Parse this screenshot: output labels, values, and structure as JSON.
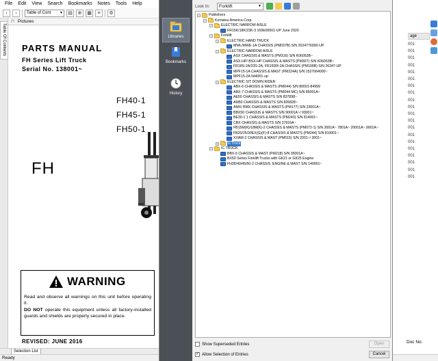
{
  "menubar": {
    "items": [
      "File",
      "Edit",
      "View",
      "Search",
      "Bookmarks",
      "Notes",
      "Tools",
      "Help"
    ]
  },
  "toolbar": {
    "toc_select": "Table of Cont"
  },
  "left_tabs": {
    "toc_tab": "Table Of Contents"
  },
  "pictures_panel": {
    "title": "Pictures"
  },
  "document": {
    "title": "PARTS MANUAL",
    "series": "FH Series Lift Truck",
    "serial": "Serial No. 138001~",
    "models": [
      "FH40-1",
      "FH45-1",
      "FH50-1"
    ],
    "big_label": "FH",
    "warning_title": "WARNING",
    "warning_text_1": "Read and observe all warnings on this unit before operating it.",
    "warning_do_not": "DO NOT",
    "warning_text_2": "operate this equipment unless all factory-installed guards and shields are properly secured in place.",
    "revised": "REVISED: JUNE 2016"
  },
  "bottom_tabs": {
    "selection_list": "Selection List"
  },
  "status_bar": {
    "text": "Ready"
  },
  "right_panel": {
    "column_header": "age",
    "cells": [
      "001",
      "001",
      "001",
      "001",
      "001",
      "001",
      "001",
      "001",
      "001",
      "001",
      "001",
      "001",
      "001",
      "001",
      "001",
      "001",
      "001",
      "001",
      "001",
      "001"
    ],
    "doc_no_label": "Doc No:"
  },
  "dialog": {
    "places": [
      {
        "label": "Libraries",
        "icon": "libraries-icon"
      },
      {
        "label": "Bookmarks",
        "icon": "bookmarks-icon"
      },
      {
        "label": "History",
        "icon": "history-icon"
      }
    ],
    "look_in_label": "Look In:",
    "look_in_value": "Forklift",
    "tree": [
      {
        "label": "Publishers",
        "level": 0,
        "type": "folder",
        "toggle": "-"
      },
      {
        "label": "Komatsu America Corp.",
        "level": 1,
        "type": "folder",
        "toggle": "-"
      },
      {
        "label": "ELECTRIC NARROW AISLE",
        "level": 2,
        "type": "folder",
        "toggle": "-"
      },
      {
        "label": "FR15K/18K/23K-3 169E00001-UP  June 2020",
        "level": 3,
        "type": "book",
        "toggle": ""
      },
      {
        "label": "Forklift",
        "level": 2,
        "type": "folder",
        "toggle": "-"
      },
      {
        "label": "ELECTRIC HAND TRUCK",
        "level": 3,
        "type": "folder",
        "toggle": "-"
      },
      {
        "label": "MWL/MWE-1A CHASSIS (PM037B) S/N 2624776000-UP",
        "level": 4,
        "type": "book",
        "toggle": ""
      },
      {
        "label": "ELECTRIC NARROW AISLE",
        "level": 3,
        "type": "folder",
        "toggle": "-"
      },
      {
        "label": "ASX CHASSIS & MASTS (PM316) S/N K06053B~",
        "level": 4,
        "type": "book",
        "toggle": ""
      },
      {
        "label": "ASX-HP/ BSX-HP CHASSIS & MASTS (PM307) S/N K06053B~",
        "level": 4,
        "type": "book",
        "toggle": ""
      },
      {
        "label": "FR18S-2A/23S-2A, FR15DR-2A CHASSIS (PM199B) S/N 26347-UP",
        "level": 4,
        "type": "book",
        "toggle": ""
      },
      {
        "label": "MPF15-1A CHASSIS & MAST (PM224A) S/N 1527064000~",
        "level": 4,
        "type": "book",
        "toggle": ""
      },
      {
        "label": "MPF15-2A 544001-up",
        "level": 4,
        "type": "book",
        "toggle": ""
      },
      {
        "label": "ELECTRIC SIT DOWN RIDER",
        "level": 3,
        "type": "folder",
        "toggle": "-"
      },
      {
        "label": "ABX-6 CHASSIS & MASTS (PM044) S/N 80001-84999",
        "level": 4,
        "type": "book",
        "toggle": ""
      },
      {
        "label": "ABX-7 CHASSIS & MASTS (PM044 MC) S/N 85001A~",
        "level": 4,
        "type": "book",
        "toggle": ""
      },
      {
        "label": "AE50 CHASSIS & MASTS S/N 837898~",
        "level": 4,
        "type": "book",
        "toggle": ""
      },
      {
        "label": "AM50 CHASSIS & MASTS S/N 826828~",
        "level": 4,
        "type": "book",
        "toggle": ""
      },
      {
        "label": "AMX/ BMX CHASSIS & MASTS (PM177) S/N 23001A~",
        "level": 4,
        "type": "book",
        "toggle": ""
      },
      {
        "label": "BBX50 CHASSIS & MASTS S/N 90001A~/ 93001~",
        "level": 4,
        "type": "book",
        "toggle": ""
      },
      {
        "label": "BE30-1 1 CHASSIS & MASTS (PM243) S/N 814001~",
        "level": 4,
        "type": "book",
        "toggle": ""
      },
      {
        "label": "CBX CHASSIS & MASTS S/N 27916A~",
        "level": 4,
        "type": "book",
        "toggle": ""
      },
      {
        "label": "FB15M(K)/18M(K)-2 CHASSIS & MASTS (PM072-1) S/N 3001A~ 7801A~ 20001A~ 9001A~",
        "level": 4,
        "type": "book",
        "toggle": ""
      },
      {
        "label": "FB20/25/30EX(G)(F)-8 CHASSIS & MASTS (PM244) S/N 810001~",
        "level": 4,
        "type": "book",
        "toggle": ""
      },
      {
        "label": "XXAM-2 CHASSIS & MAST (PM015) S/N 2001~/ 3001~",
        "level": 4,
        "type": "book",
        "toggle": ""
      },
      {
        "label": "Ic Truck",
        "level": 3,
        "type": "folder",
        "toggle": "+",
        "selected": true
      },
      {
        "label": "IC TRUCK",
        "level": 2,
        "type": "folder",
        "toggle": "-"
      },
      {
        "label": "BBX-5 CHASSIS & MAST (PM218) S/N 35001A~",
        "level": 3,
        "type": "book",
        "toggle": ""
      },
      {
        "label": "BX50 Series Forklift Trucks with GK21 or GK25 Engine",
        "level": 3,
        "type": "book",
        "toggle": ""
      },
      {
        "label": "FH35/40/45/50-2 CHASSIS. ENGINE & MAST S/N 140001~",
        "level": 3,
        "type": "book",
        "toggle": ""
      }
    ],
    "show_superseded": {
      "label": "Show Superseded Entries",
      "checked": false
    },
    "allow_selection": {
      "label": "Allow Selection of Entries",
      "checked": true
    },
    "open_button": "Open",
    "cancel_button": "Cancel"
  },
  "colors": {
    "places_bar": "#4b4f56",
    "selection": "#3178c6",
    "folder": "#f2cc58",
    "book": "#2f6fc4"
  }
}
